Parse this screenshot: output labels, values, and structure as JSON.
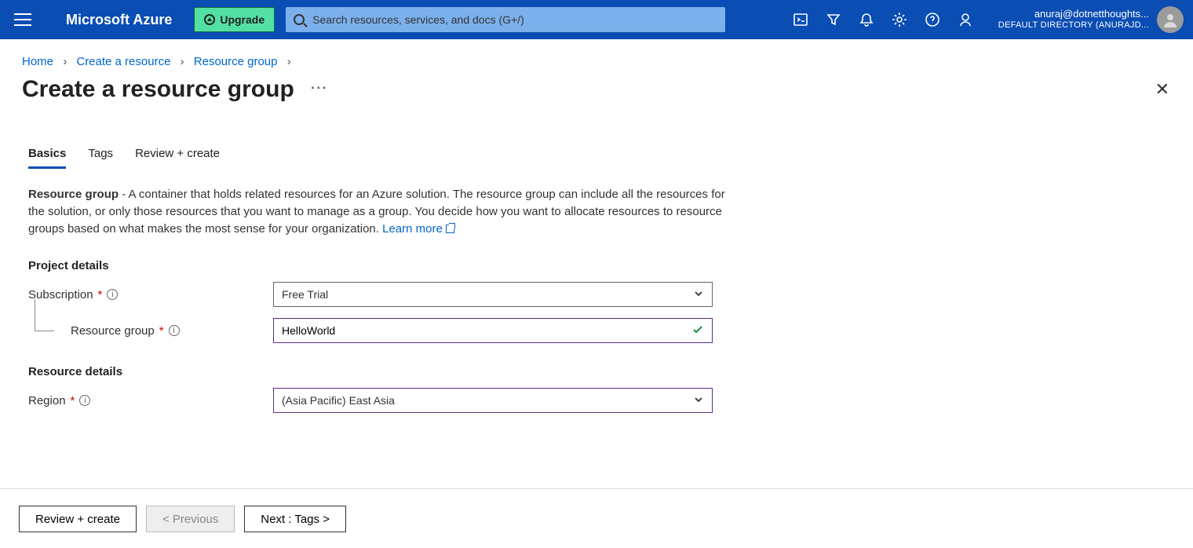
{
  "header": {
    "brand": "Microsoft Azure",
    "upgrade": "Upgrade",
    "search_placeholder": "Search resources, services, and docs (G+/)",
    "account_email": "anuraj@dotnetthoughts...",
    "account_directory": "DEFAULT DIRECTORY (ANURAJD..."
  },
  "breadcrumbs": {
    "home": "Home",
    "create": "Create a resource",
    "rg": "Resource group"
  },
  "page": {
    "title": "Create a resource group",
    "more": "···",
    "close": "✕"
  },
  "tabs": {
    "basics": "Basics",
    "tags": "Tags",
    "review": "Review + create"
  },
  "content": {
    "desc_bold": "Resource group",
    "desc_text": " - A container that holds related resources for an Azure solution. The resource group can include all the resources for the solution, or only those resources that you want to manage as a group. You decide how you want to allocate resources to resource groups based on what makes the most sense for your organization. ",
    "learn_more": "Learn more",
    "project_heading": "Project details",
    "resource_heading": "Resource details",
    "labels": {
      "subscription": "Subscription",
      "resource_group": "Resource group",
      "region": "Region"
    },
    "values": {
      "subscription": "Free Trial",
      "resource_group": "HelloWorld",
      "region": "(Asia Pacific) East Asia"
    }
  },
  "footer": {
    "review": "Review + create",
    "previous": "< Previous",
    "next": "Next : Tags >"
  }
}
